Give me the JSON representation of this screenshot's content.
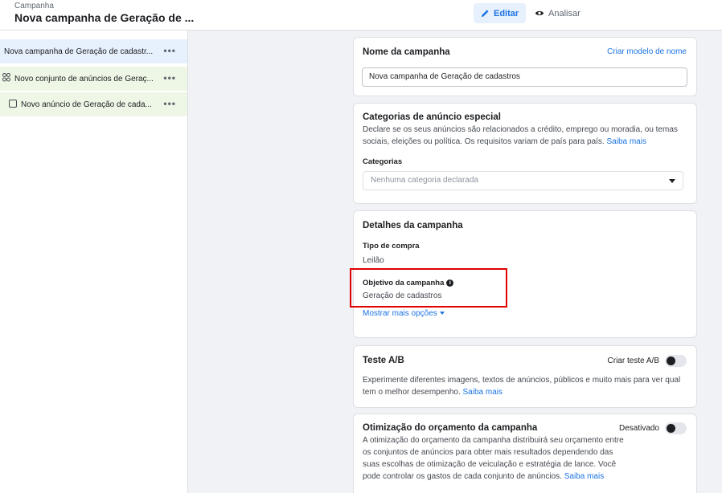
{
  "header": {
    "crumb": "Campanha",
    "title": "Nova campanha de Geração de ...",
    "edit_label": "Editar",
    "review_label": "Analisar"
  },
  "sidebar": {
    "items": [
      {
        "label": "Nova campanha de Geração de cadastr...",
        "more": "•••"
      },
      {
        "label": "Novo conjunto de anúncios de Geraç...",
        "more": "•••"
      },
      {
        "label": "Novo anúncio de Geração de cada...",
        "more": "•••"
      }
    ]
  },
  "campaign_name": {
    "heading": "Nome da campanha",
    "template_link": "Criar modelo de nome",
    "value": "Nova campanha de Geração de cadastros"
  },
  "special_categories": {
    "heading": "Categorias de anúncio especial",
    "description": "Declare se os seus anúncios são relacionados a crédito, emprego ou moradia, ou temas sociais, eleições ou política. Os requisitos variam de país para país.",
    "learn_more": "Saiba mais",
    "categories_label": "Categorias",
    "select_placeholder": "Nenhuma categoria declarada"
  },
  "details": {
    "heading": "Detalhes da campanha",
    "buy_type_label": "Tipo de compra",
    "buy_type_value": "Leilão",
    "objective_label": "Objetivo da campanha",
    "objective_value": "Geração de cadastros",
    "more_options": "Mostrar mais opções"
  },
  "ab_test": {
    "heading": "Teste A/B",
    "toggle_label": "Criar teste A/B",
    "enabled": false,
    "description": "Experimente diferentes imagens, textos de anúncios, públicos e muito mais para ver qual tem o melhor desempenho.",
    "learn_more": "Saiba mais"
  },
  "budget_optimization": {
    "heading": "Otimização do orçamento da campanha",
    "toggle_label": "Desativado",
    "enabled": false,
    "description": "A otimização do orçamento da campanha distribuirá seu orçamento entre os conjuntos de anúncios para obter mais resultados dependendo das suas escolhas de otimização de veiculação e estratégia de lance. Você pode controlar os gastos de cada conjunto de anúncios.",
    "learn_more": "Saiba mais"
  },
  "colors": {
    "accent": "#1b74e4",
    "highlight_box": "#e10000",
    "campaign_row_bg": "#e7f0fd",
    "adset_row_bg": "#eef6e6"
  },
  "icons": {
    "edit": "pencil-icon",
    "review": "eye-icon",
    "adset": "grid-icon",
    "ad": "ad-square-icon",
    "info": "info-icon",
    "dropdown": "caret-down-icon"
  }
}
